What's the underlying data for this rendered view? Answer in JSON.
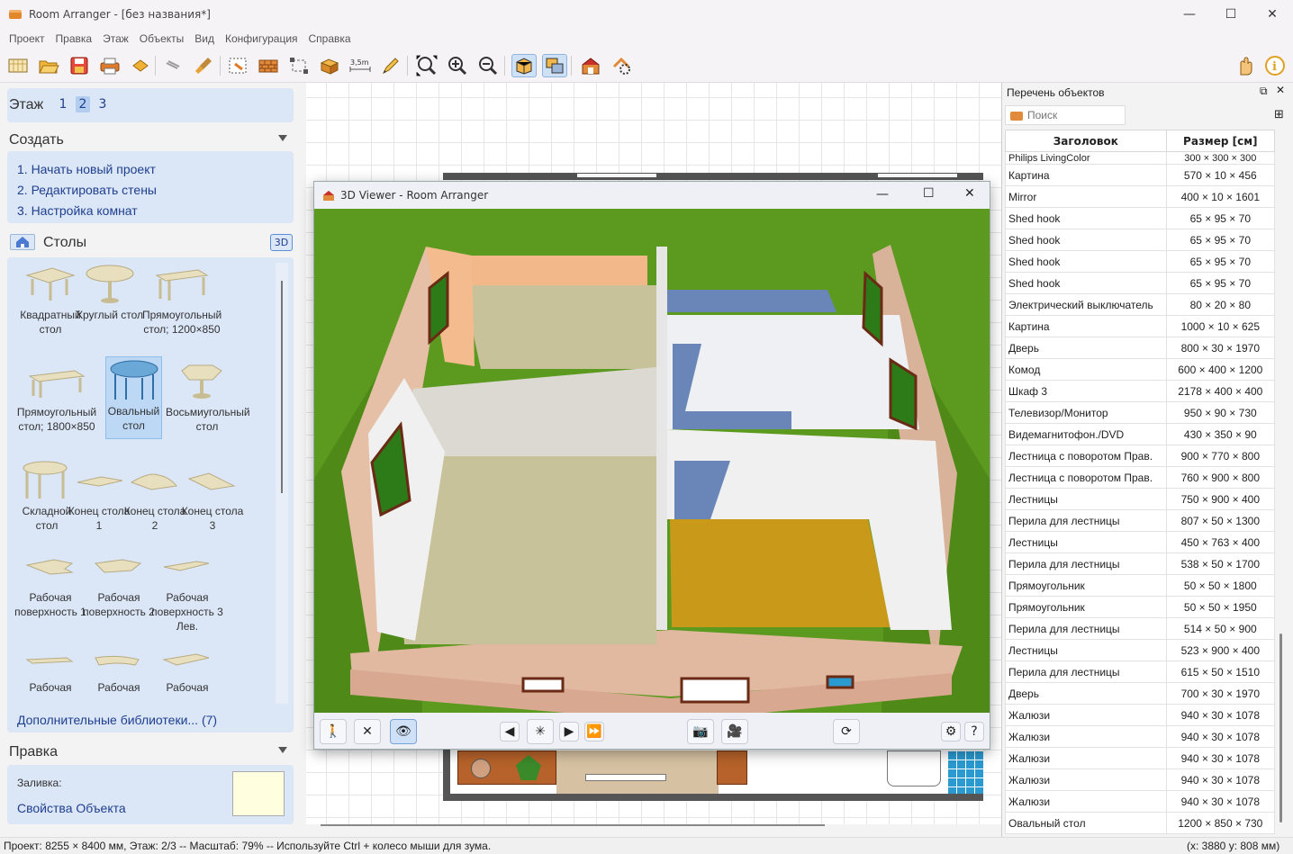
{
  "window": {
    "title": "Room Arranger - [без названия*]"
  },
  "menu": [
    "Проект",
    "Правка",
    "Этаж",
    "Объекты",
    "Вид",
    "Конфигурация",
    "Справка"
  ],
  "floor": {
    "label": "Этаж",
    "levels": [
      "1",
      "2",
      "3"
    ],
    "active": "2"
  },
  "create": {
    "title": "Создать",
    "links": [
      "1. Начать новый проект",
      "2. Редактировать стены",
      "3. Настройка комнат"
    ]
  },
  "library": {
    "title": "Столы",
    "badge": "3D",
    "items": [
      {
        "label": "Квадратный стол"
      },
      {
        "label": "Круглый стол"
      },
      {
        "label": "Прямоугольный стол; 1200×850"
      },
      {
        "label": "Прямоугольный стол; 1800×850"
      },
      {
        "label": "Овальный стол",
        "selected": true
      },
      {
        "label": "Восьмиугольный стол"
      },
      {
        "label": "Складной стол"
      },
      {
        "label": "Конец стола 1"
      },
      {
        "label": "Конец стола 2"
      },
      {
        "label": "Конец стола 3"
      },
      {
        "label": "Рабочая поверхность 1"
      },
      {
        "label": "Рабочая поверхность 2"
      },
      {
        "label": "Рабочая поверхность 3 Лев."
      },
      {
        "label": "Рабочая"
      },
      {
        "label": "Рабочая"
      },
      {
        "label": "Рабочая"
      }
    ],
    "more_link": "Дополнительные библиотеки... (7)"
  },
  "edit": {
    "title": "Правка",
    "fill_label": "Заливка:",
    "props_link": "Свойства Объекта",
    "fill_color": "#ffffe0"
  },
  "viewer": {
    "title": "3D Viewer - Room Arranger"
  },
  "objects": {
    "title": "Перечень объектов",
    "search_placeholder": "Поиск",
    "col_title": "Заголовок",
    "col_size": "Размер [см]",
    "cut_row": {
      "name": "Philips LivingColor",
      "size": "300 × 300 × 300"
    },
    "rows": [
      {
        "name": "Картина",
        "size": "570 × 10 × 456"
      },
      {
        "name": "Mirror",
        "size": "400 × 10 × 1601"
      },
      {
        "name": "Shed hook",
        "size": "65 × 95 × 70"
      },
      {
        "name": "Shed hook",
        "size": "65 × 95 × 70"
      },
      {
        "name": "Shed hook",
        "size": "65 × 95 × 70"
      },
      {
        "name": "Shed hook",
        "size": "65 × 95 × 70"
      },
      {
        "name": "Электрический выключатель",
        "size": "80 × 20 × 80"
      },
      {
        "name": "Картина",
        "size": "1000 × 10 × 625"
      },
      {
        "name": "Дверь",
        "size": "800 × 30 × 1970"
      },
      {
        "name": "Комод",
        "size": "600 × 400 × 1200"
      },
      {
        "name": "Шкаф 3",
        "size": "2178 × 400 × 400"
      },
      {
        "name": "Телевизор/Монитор",
        "size": "950 × 90 × 730"
      },
      {
        "name": "Видемагнитофон./DVD",
        "size": "430 × 350 × 90"
      },
      {
        "name": "Лестница с поворотом Прав.",
        "size": "900 × 770 × 800"
      },
      {
        "name": "Лестница с поворотом Прав.",
        "size": "760 × 900 × 800"
      },
      {
        "name": "Лестницы",
        "size": "750 × 900 × 400"
      },
      {
        "name": "Перила для лестницы",
        "size": "807 × 50 × 1300"
      },
      {
        "name": "Лестницы",
        "size": "450 × 763 × 400"
      },
      {
        "name": "Перила для лестницы",
        "size": "538 × 50 × 1700"
      },
      {
        "name": "Прямоугольник",
        "size": "50 × 50 × 1800"
      },
      {
        "name": "Прямоугольник",
        "size": "50 × 50 × 1950"
      },
      {
        "name": "Перила для лестницы",
        "size": "514 × 50 × 900"
      },
      {
        "name": "Лестницы",
        "size": "523 × 900 × 400"
      },
      {
        "name": "Перила для лестницы",
        "size": "615 × 50 × 1510"
      },
      {
        "name": "Дверь",
        "size": "700 × 30 × 1970"
      },
      {
        "name": "Жалюзи",
        "size": "940 × 30 × 1078"
      },
      {
        "name": "Жалюзи",
        "size": "940 × 30 × 1078"
      },
      {
        "name": "Жалюзи",
        "size": "940 × 30 × 1078"
      },
      {
        "name": "Жалюзи",
        "size": "940 × 30 × 1078"
      },
      {
        "name": "Жалюзи",
        "size": "940 × 30 × 1078"
      },
      {
        "name": "Овальный стол",
        "size": "1200 × 850 × 730"
      }
    ]
  },
  "status": {
    "left": "Проект: 8255 × 8400 мм, Этаж: 2/3 -- Масштаб: 79% -- Используйте Ctrl + колесо мыши для зума.",
    "right": "(x: 3880 y: 808 мм)"
  }
}
